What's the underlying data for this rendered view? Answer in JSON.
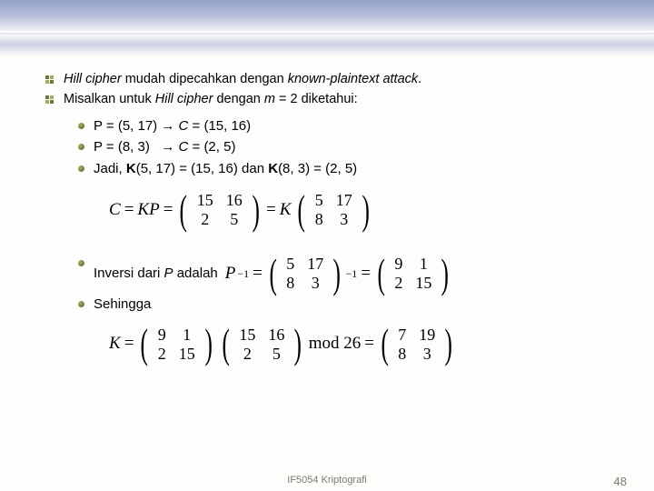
{
  "l1a": "Hill cipher",
  "l1b": " mudah dipecahkan dengan ",
  "l1c": "known-plaintext attack",
  "l1d": ".",
  "l2a": "Misalkan untuk ",
  "l2b": "Hill cipher",
  "l2c": " dengan ",
  "l2d": "m",
  "l2e": " = 2 diketahui:",
  "b1a": "P = (5, 17) ",
  "b1arrow": "→",
  "b1b": " C",
  "b1c": " = (15, 16)",
  "b2a": "P = (8, 3)   ",
  "b2arrow": "→",
  "b2b": " C",
  "b2c": " = (2, 5)",
  "b3a": "Jadi, ",
  "b3b": "K",
  "b3c": "(5, 17) = (15, 16) dan ",
  "b3d": "K",
  "b3e": "(8, 3) = (2, 5)",
  "eq1_lhs1": "C",
  "eq1_eq": " = ",
  "eq1_lhs2": "KP",
  "eq1_m1": [
    [
      "15",
      "16"
    ],
    [
      "2",
      "5"
    ]
  ],
  "eq1_mid": "K",
  "eq1_m2": [
    [
      "5",
      "17"
    ],
    [
      "8",
      "3"
    ]
  ],
  "inv_a": "Inversi dari ",
  "inv_b": "P",
  "inv_c": " adalah",
  "inv_lhs": "P",
  "inv_m1": [
    [
      "5",
      "17"
    ],
    [
      "8",
      "3"
    ]
  ],
  "inv_m2": [
    [
      "9",
      "1"
    ],
    [
      "2",
      "15"
    ]
  ],
  "seh": "Sehingga",
  "k_lhs": "K",
  "k_m1": [
    [
      "9",
      "1"
    ],
    [
      "2",
      "15"
    ]
  ],
  "k_m2": [
    [
      "15",
      "16"
    ],
    [
      "2",
      "5"
    ]
  ],
  "k_mod": "mod 26",
  "k_m3": [
    [
      "7",
      "19"
    ],
    [
      "8",
      "3"
    ]
  ],
  "footer_center": "IF5054 Kriptografi",
  "footer_page": "48",
  "chart_data": {
    "type": "table",
    "title": "Hill cipher known-plaintext attack (m = 2)",
    "plaintext_pairs": [
      [
        5,
        17
      ],
      [
        8,
        3
      ]
    ],
    "ciphertext_pairs": [
      [
        15,
        16
      ],
      [
        2,
        5
      ]
    ],
    "C_matrix": [
      [
        15,
        16
      ],
      [
        2,
        5
      ]
    ],
    "P_matrix": [
      [
        5,
        17
      ],
      [
        8,
        3
      ]
    ],
    "P_inverse_mod26": [
      [
        9,
        1
      ],
      [
        2,
        15
      ]
    ],
    "K_matrix_mod26": [
      [
        7,
        19
      ],
      [
        8,
        3
      ]
    ],
    "modulus": 26
  }
}
